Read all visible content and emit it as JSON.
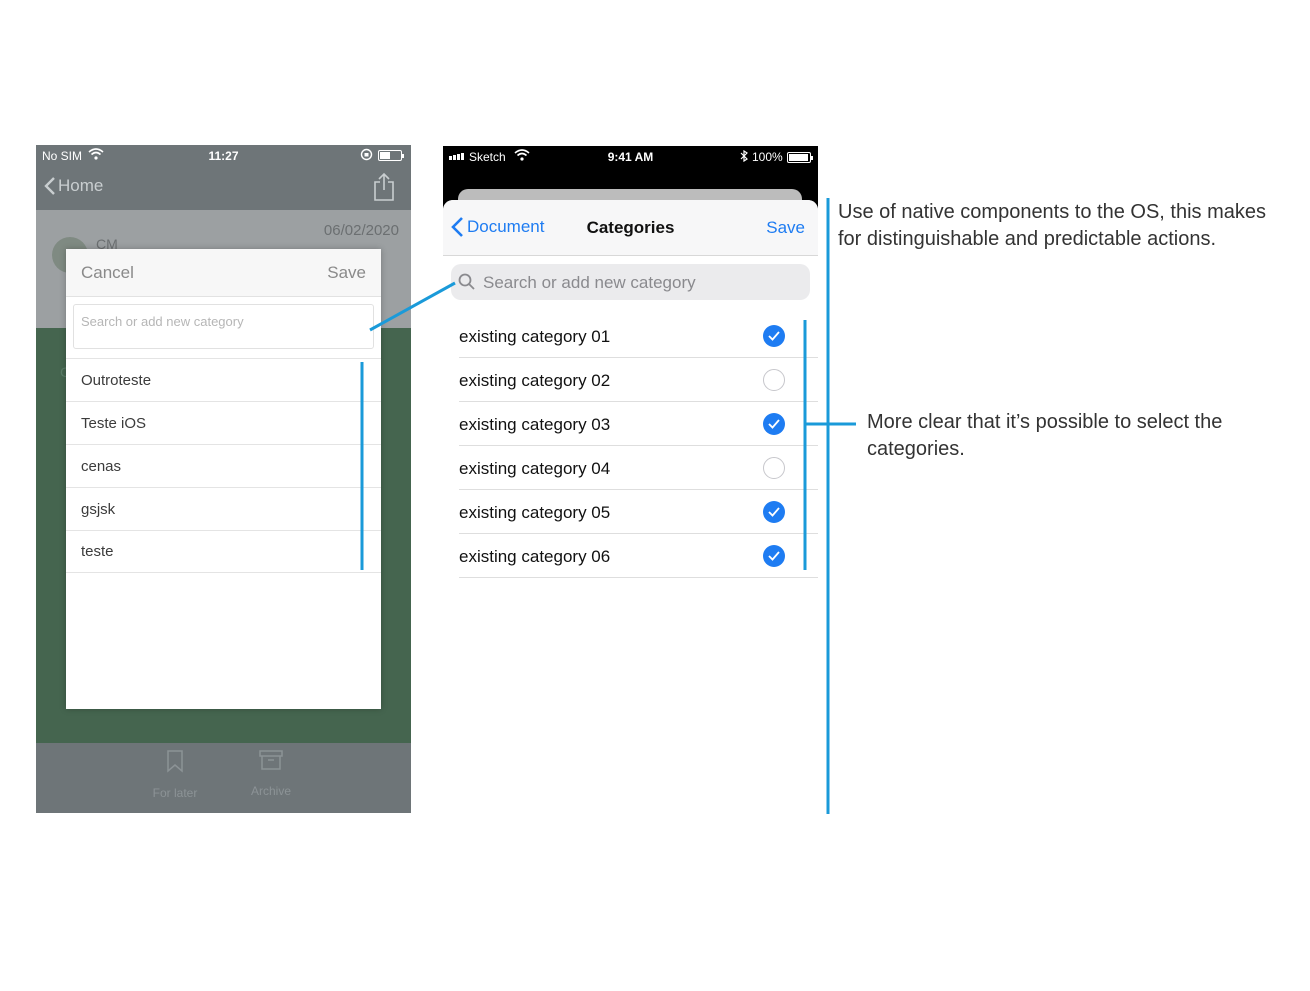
{
  "old_screen": {
    "status": {
      "carrier": "No SIM",
      "time": "11:27"
    },
    "nav": {
      "back_label": "Home"
    },
    "document": {
      "date": "06/02/2020",
      "author": "CM",
      "ghost": "C"
    },
    "modal": {
      "cancel_label": "Cancel",
      "save_label": "Save",
      "search_placeholder": "Search or add new category",
      "items": [
        "Outroteste",
        "Teste iOS",
        "cenas",
        "gsjsk",
        "teste"
      ]
    },
    "tabs": [
      {
        "label": "For later",
        "icon": "bookmark-icon"
      },
      {
        "label": "Archive",
        "icon": "archive-icon"
      }
    ]
  },
  "new_screen": {
    "status": {
      "carrier": "Sketch",
      "time": "9:41 AM",
      "battery": "100%"
    },
    "nav": {
      "back_label": "Document",
      "title": "Categories",
      "save_label": "Save"
    },
    "search_placeholder": "Search or add new category",
    "categories": [
      {
        "label": "existing category 01",
        "selected": true
      },
      {
        "label": "existing category 02",
        "selected": false
      },
      {
        "label": "existing category 03",
        "selected": true
      },
      {
        "label": "existing category 04",
        "selected": false
      },
      {
        "label": "existing category 05",
        "selected": true
      },
      {
        "label": "existing category 06",
        "selected": true
      }
    ],
    "accent": "#1e7cf2"
  },
  "annotations": {
    "note_1": "Use of native components to the OS, this makes for distinguishable and predictable actions.",
    "note_2": "More clear that it’s possible to select the categories.",
    "line_color": "#1a9ad9"
  }
}
